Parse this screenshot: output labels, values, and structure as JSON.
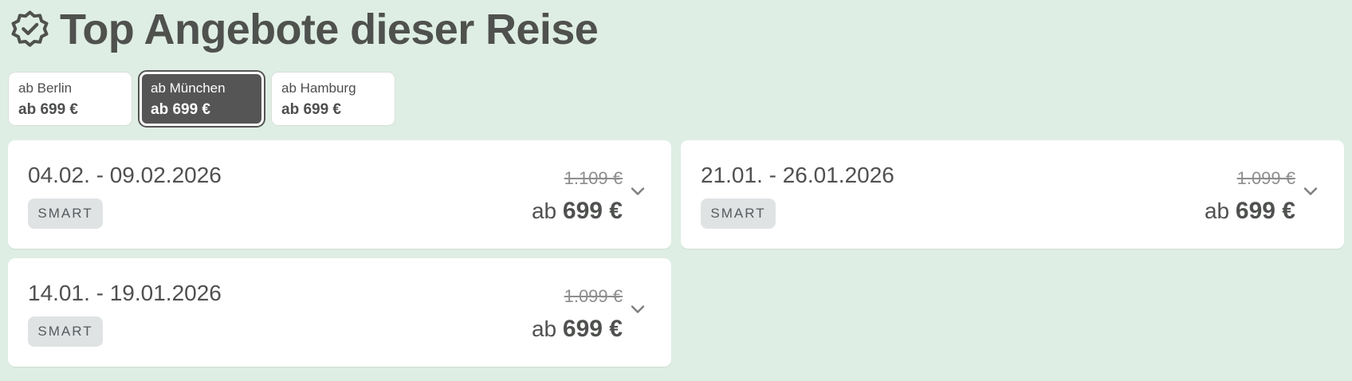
{
  "header": {
    "title": "Top Angebote dieser Reise",
    "icon": "verified-badge-icon"
  },
  "tabs": [
    {
      "city": "ab Berlin",
      "price": "ab 699 €",
      "selected": false
    },
    {
      "city": "ab München",
      "price": "ab 699 €",
      "selected": true
    },
    {
      "city": "ab Hamburg",
      "price": "ab 699 €",
      "selected": false
    }
  ],
  "offers": [
    {
      "dates": "04.02. - 09.02.2026",
      "tag": "SMART",
      "old_price": "1.109 €",
      "price_prefix": "ab",
      "price": "699 €",
      "icon": "chevron-down-icon"
    },
    {
      "dates": "21.01. - 26.01.2026",
      "tag": "SMART",
      "old_price": "1.099 €",
      "price_prefix": "ab",
      "price": "699 €",
      "icon": "chevron-down-icon"
    },
    {
      "dates": "14.01. - 19.01.2026",
      "tag": "SMART",
      "old_price": "1.099 €",
      "price_prefix": "ab",
      "price": "699 €",
      "icon": "chevron-down-icon"
    }
  ],
  "colors": {
    "background": "#dfeee4",
    "text": "#4d4f4d",
    "selected_tab": "#555555",
    "card": "#ffffff",
    "tag_background": "#e0e3e4",
    "muted_price": "#8e8e8e"
  }
}
